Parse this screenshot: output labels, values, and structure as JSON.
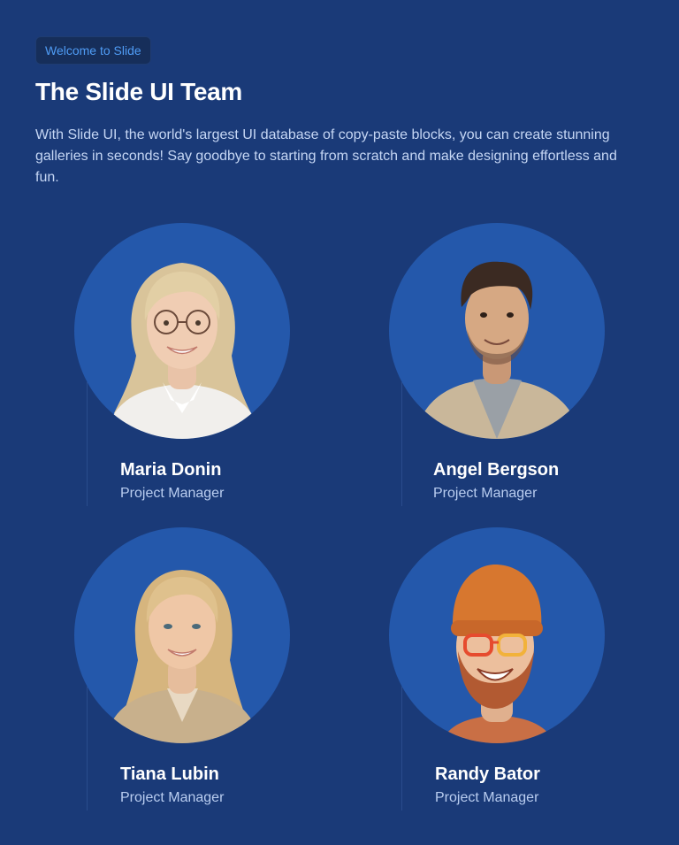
{
  "header": {
    "badge": "Welcome to Slide",
    "title": "The Slide UI Team",
    "intro": "With Slide UI, the world's largest UI database of copy-paste blocks, you can create stunning galleries in seconds! Say goodbye to starting from scratch and make designing effortless and fun."
  },
  "team": [
    {
      "name": "Maria Donin",
      "role": "Project Manager"
    },
    {
      "name": "Angel Bergson",
      "role": "Project Manager"
    },
    {
      "name": "Tiana Lubin",
      "role": "Project Manager"
    },
    {
      "name": "Randy Bator",
      "role": "Project Manager"
    }
  ],
  "colors": {
    "background": "#1a3a78",
    "circle": "#2458ab",
    "badge_text": "#4f9cf5"
  }
}
